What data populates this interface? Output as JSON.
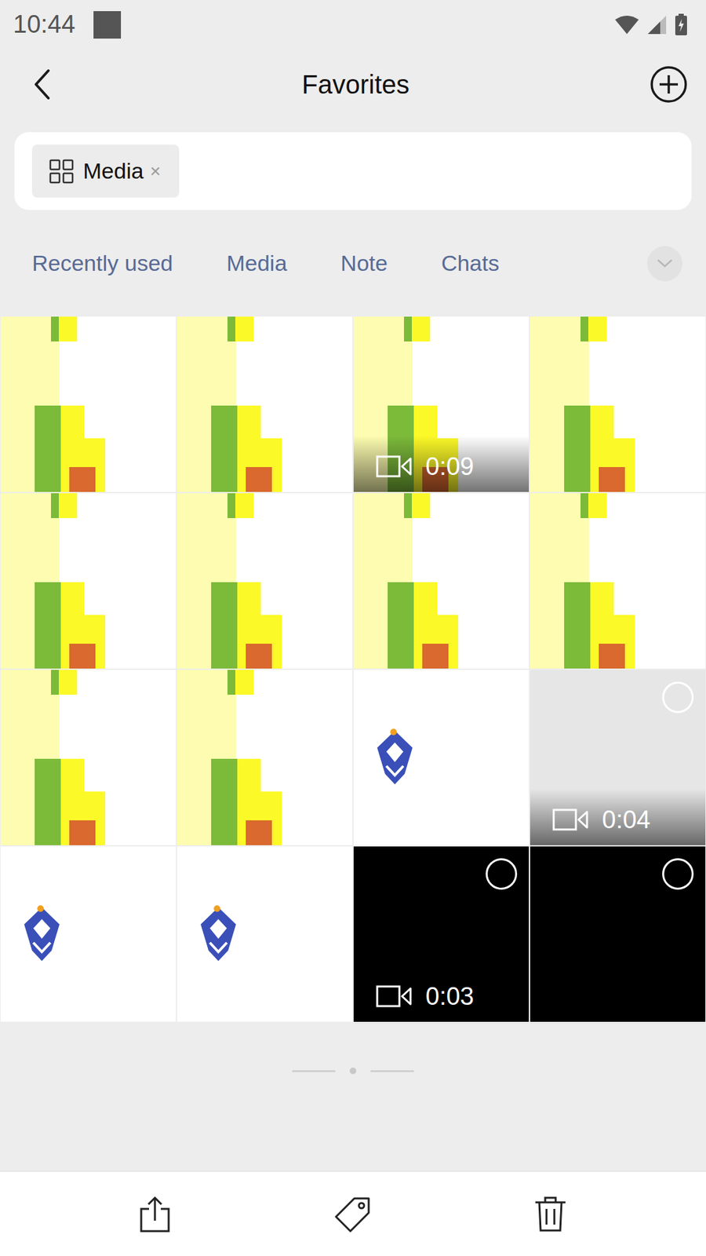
{
  "status_bar": {
    "time": "10:44"
  },
  "header": {
    "title": "Favorites"
  },
  "search": {
    "chips": [
      {
        "label": "Media",
        "remove": "×"
      }
    ]
  },
  "categories": [
    {
      "label": "Recently used"
    },
    {
      "label": "Media"
    },
    {
      "label": "Note"
    },
    {
      "label": "Chats"
    }
  ],
  "grid": [
    {
      "kind": "chart",
      "duration": "",
      "check_shown": false,
      "selected": false
    },
    {
      "kind": "chart",
      "duration": "",
      "check_shown": false,
      "selected": false
    },
    {
      "kind": "chart",
      "duration": "0:09",
      "check_shown": false,
      "selected": false
    },
    {
      "kind": "chart",
      "duration": "",
      "check_shown": false,
      "selected": false
    },
    {
      "kind": "chart",
      "duration": "",
      "check_shown": false,
      "selected": false
    },
    {
      "kind": "chart",
      "duration": "",
      "check_shown": false,
      "selected": false
    },
    {
      "kind": "chart",
      "duration": "",
      "check_shown": false,
      "selected": false
    },
    {
      "kind": "chart",
      "duration": "",
      "check_shown": false,
      "selected": false
    },
    {
      "kind": "chart",
      "duration": "",
      "check_shown": false,
      "selected": false
    },
    {
      "kind": "chart",
      "duration": "",
      "check_shown": false,
      "selected": false
    },
    {
      "kind": "logo",
      "duration": "",
      "check_shown": false,
      "selected": false
    },
    {
      "kind": "blank",
      "duration": "0:04",
      "check_shown": true,
      "selected": false
    },
    {
      "kind": "logo",
      "duration": "",
      "check_shown": false,
      "selected": false
    },
    {
      "kind": "logo",
      "duration": "",
      "check_shown": false,
      "selected": false
    },
    {
      "kind": "dark",
      "duration": "0:03",
      "check_shown": true,
      "selected": false
    },
    {
      "kind": "dark",
      "duration": "",
      "check_shown": true,
      "selected": false
    }
  ],
  "pager": {
    "count": 3,
    "current": 1
  }
}
